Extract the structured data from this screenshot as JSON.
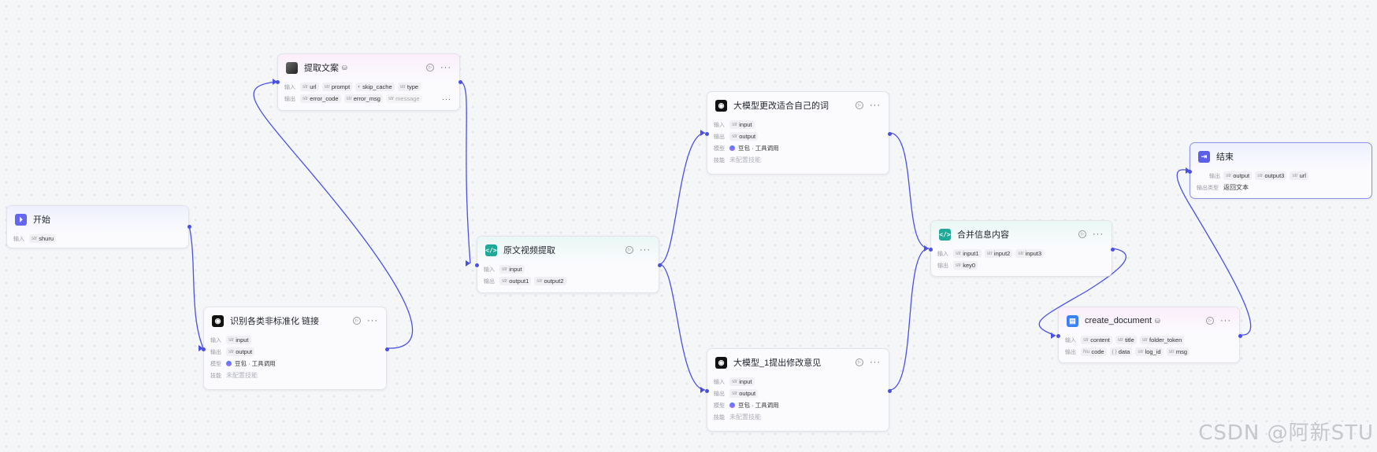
{
  "labels": {
    "input": "输入",
    "output": "输出",
    "model": "模型",
    "skill": "技能",
    "output_type": "输出类型",
    "type_str": "str",
    "type_num": "Nu",
    "type_obj": "{ }"
  },
  "nodes": {
    "start": {
      "title": "开始",
      "inputs": [
        "shuru"
      ]
    },
    "extract_copy": {
      "title": "提取文案",
      "inputs": [
        "url",
        "prompt",
        "skip_cache",
        "type"
      ],
      "outputs": [
        "error_code",
        "error_msg",
        "message"
      ]
    },
    "identify_link": {
      "title": "识别各类非标准化 链接",
      "inputs": [
        "input"
      ],
      "outputs": [
        "output"
      ],
      "model": "豆包 · 工具调用",
      "skill": "未配置技能"
    },
    "video_extract": {
      "title": "原文视频提取",
      "inputs": [
        "input"
      ],
      "outputs": [
        "output1",
        "output2"
      ]
    },
    "llm_rewrite": {
      "title": "大模型更改适合自己的词",
      "inputs": [
        "input"
      ],
      "outputs": [
        "output"
      ],
      "model": "豆包 · 工具调用",
      "skill": "未配置技能"
    },
    "llm_suggest": {
      "title": "大模型_1提出修改意见",
      "inputs": [
        "input"
      ],
      "outputs": [
        "output"
      ],
      "model": "豆包 · 工具调用",
      "skill": "未配置技能"
    },
    "merge": {
      "title": "合并信息内容",
      "inputs": [
        "input1",
        "input2",
        "input3"
      ],
      "outputs": [
        "key0"
      ]
    },
    "create_document": {
      "title": "create_document",
      "inputs": [
        "content",
        "title",
        "folder_token"
      ],
      "outputs": [
        "code",
        "data",
        "log_id",
        "msg"
      ]
    },
    "end": {
      "title": "结束",
      "outputs": [
        "output",
        "output3",
        "url"
      ],
      "output_type": "返回文本"
    }
  },
  "watermark": "CSDN @阿新STU",
  "colors": {
    "edge": "#4a50e2",
    "accent": "#6366f1",
    "code_node": "#1fa996"
  },
  "icons": {
    "start": "start-icon",
    "end": "end-icon",
    "code": "code-icon",
    "llm": "llm-icon",
    "plugin": "plugin-icon",
    "doc": "document-icon",
    "more": "more-icon",
    "run": "run-icon"
  }
}
